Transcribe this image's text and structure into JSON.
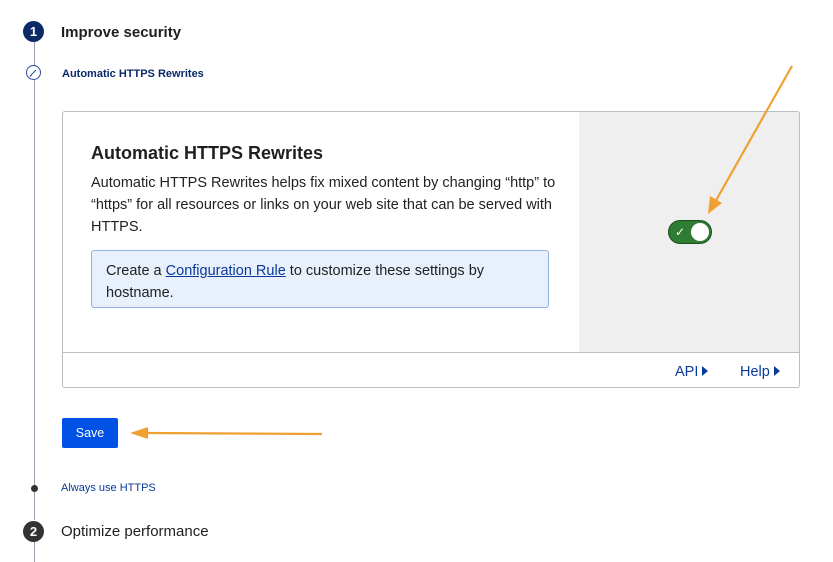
{
  "steps": [
    {
      "number": "1",
      "title": "Improve security"
    },
    {
      "number": "2",
      "title": "Optimize performance"
    }
  ],
  "substeps": {
    "current": "Automatic HTTPS Rewrites",
    "next": "Always use HTTPS"
  },
  "card": {
    "title": "Automatic HTTPS Rewrites",
    "description": "Automatic HTTPS Rewrites helps fix mixed content by changing “http” to “https” for all resources or links on your web site that can be served with HTTPS.",
    "info_prefix": "Create a ",
    "info_link": "Configuration Rule",
    "info_suffix": " to customize these settings by hostname.",
    "toggle_state": "on",
    "footer_api": "API",
    "footer_help": "Help"
  },
  "actions": {
    "save_label": "Save"
  },
  "colors": {
    "accent": "#0051e6",
    "toggle_on": "#2f7d32",
    "annotation_arrow": "#f0a030",
    "step_active": "#0c2a66",
    "step_inactive": "#333333"
  },
  "icons": {
    "substep_current": "pencil-icon",
    "toggle": "check-icon",
    "footer": "triangle-right-icon"
  }
}
